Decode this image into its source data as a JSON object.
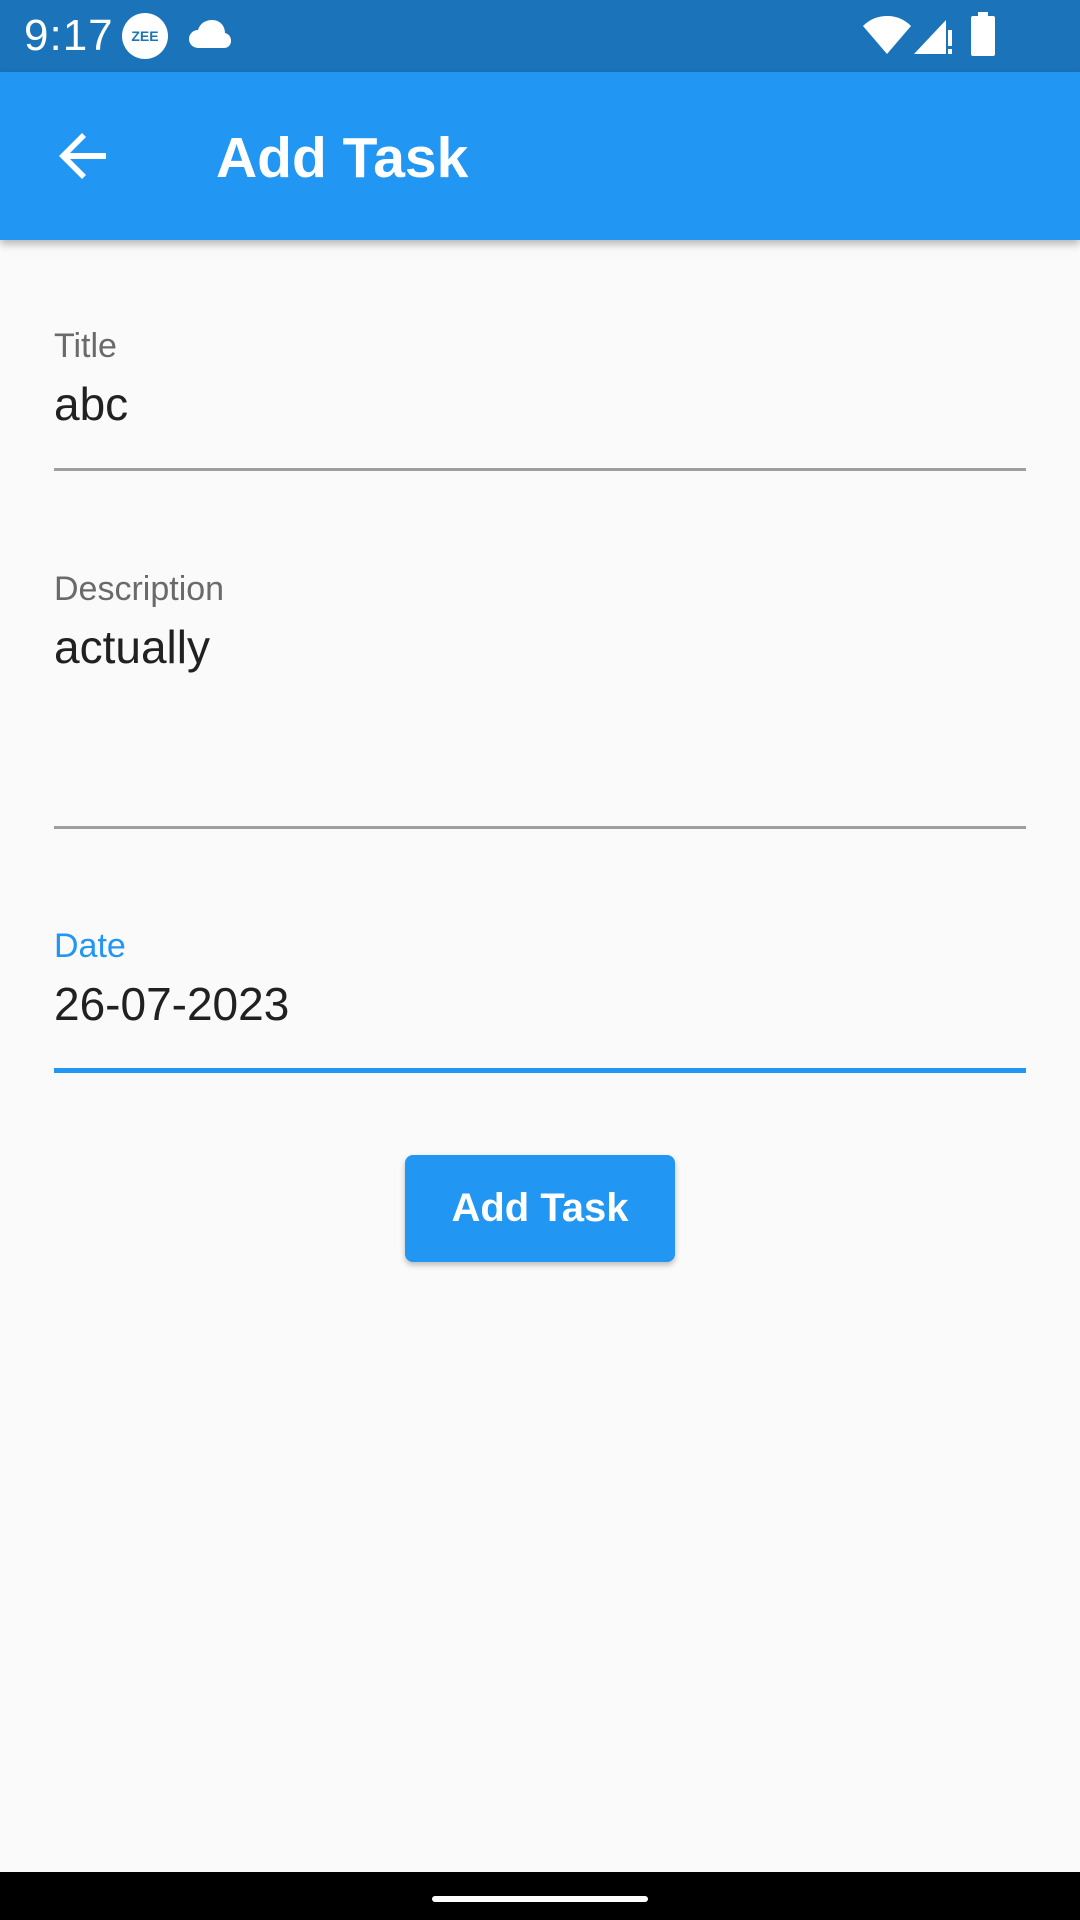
{
  "status_bar": {
    "time": "9:17",
    "notification_badge": "ZEE",
    "icons": [
      "zee-icon",
      "cloud-icon",
      "wifi-icon",
      "signal-icon",
      "battery-icon"
    ]
  },
  "app_bar": {
    "title": "Add Task",
    "back_icon": "arrow-back-icon",
    "color": "#2196f3"
  },
  "form": {
    "title_field": {
      "label": "Title",
      "value": "abc"
    },
    "description_field": {
      "label": "Description",
      "value": "actually"
    },
    "date_field": {
      "label": "Date",
      "value": "26-07-2023",
      "focused": true
    }
  },
  "submit_button": {
    "label": "Add Task",
    "color": "#2196f3"
  },
  "colors": {
    "accent": "#2196f3",
    "status_bar": "#1b73b9",
    "background": "#fafafa"
  }
}
